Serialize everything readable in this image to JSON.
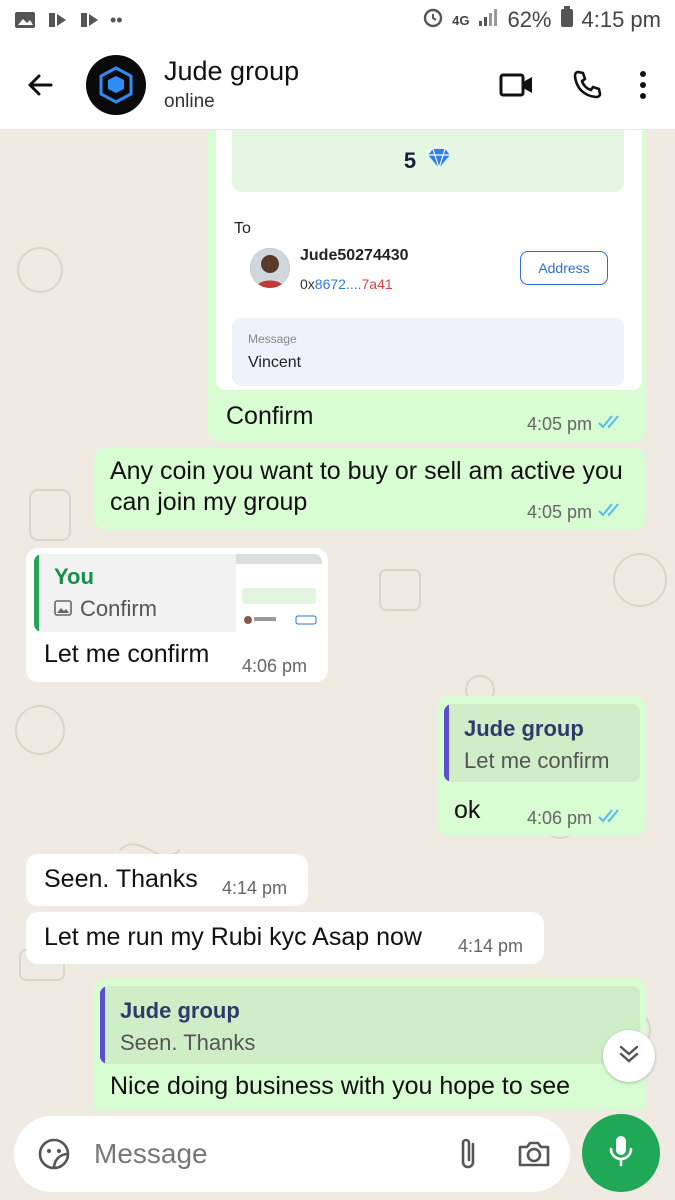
{
  "statusbar": {
    "network": "4G",
    "battery": "62%",
    "time": "4:15 pm"
  },
  "header": {
    "title": "Jude group",
    "status": "online"
  },
  "card": {
    "amount": "5",
    "to_label": "To",
    "contact_name": "Jude50274430",
    "address_prefix": "0x",
    "address_mid": "8672....",
    "address_end": "7a41",
    "address_button": "Address",
    "message_label": "Message",
    "message_value": "Vincent"
  },
  "messages": {
    "m1": {
      "text": "Confirm",
      "time": "4:05 pm"
    },
    "m2": {
      "text": "Any coin you want to buy or sell am active you can join my group",
      "time": "4:05 pm"
    },
    "m3": {
      "quote_author": "You",
      "quote_text": "Confirm",
      "text": "Let me confirm",
      "time": "4:06 pm"
    },
    "m4": {
      "quote_author": "Jude group",
      "quote_text": "Let me confirm",
      "text": "ok",
      "time": "4:06 pm"
    },
    "m5": {
      "text": "Seen. Thanks",
      "time": "4:14 pm"
    },
    "m6": {
      "text": "Let me run my Rubi kyc Asap now",
      "time": "4:14 pm"
    },
    "m7": {
      "quote_author": "Jude group",
      "quote_text": "Seen. Thanks",
      "text": "Nice doing business with you hope to see"
    }
  },
  "composer": {
    "placeholder": "Message"
  },
  "colors": {
    "outgoing": "#d9fdd3",
    "incoming": "#ffffff",
    "accent": "#1fa855",
    "ticks": "#53bdeb"
  }
}
